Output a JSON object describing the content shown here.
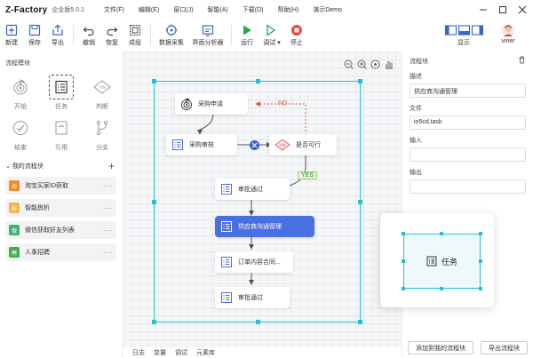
{
  "app": {
    "logo": "Z-Factory",
    "edition": "企业版5.0.1",
    "menus": [
      "文件(F)",
      "编辑(E)",
      "窗口(J)",
      "智能(A)",
      "下载(D)",
      "帮助(H)",
      "演示Demo"
    ]
  },
  "toolbar": {
    "new": "新建",
    "save": "保存",
    "export": "导出",
    "undo": "撤销",
    "redo": "恢复",
    "group": "成组",
    "datacollect": "数据采集",
    "uianalyzer": "界面分析器",
    "run": "运行",
    "debug": "调试",
    "stop": "停止",
    "display": "显示",
    "user": "viner"
  },
  "left": {
    "blocks_title": "流程模块",
    "blocks": [
      "开始",
      "任务",
      "判断",
      "结束",
      "引用",
      "分支"
    ],
    "my_title": "我的流程块",
    "my_items": [
      {
        "label": "淘宝买家ID获取",
        "color": "#f08a24",
        "icon": "淘"
      },
      {
        "label": "智能舆析",
        "color": "#f2b84b",
        "icon": "析"
      },
      {
        "label": "微信获取好友列表",
        "color": "#3cb371",
        "icon": "微"
      },
      {
        "label": "人事招聘",
        "color": "#37b24d",
        "icon": "聘"
      }
    ]
  },
  "flow": {
    "nodes": {
      "purchase_apply": "采购申请",
      "purchase_review": "采购审核",
      "feasible": "是否可行",
      "approve1": "审批通过",
      "supplier": "供应商沟通管理",
      "contract": "订单内容合同...",
      "approve2": "审批通过"
    },
    "no_label": "NO",
    "yes_label": "YES"
  },
  "bottom_tabs": [
    "日志",
    "变量",
    "调试",
    "元素库"
  ],
  "right": {
    "title": "流程块",
    "desc_label": "描述",
    "desc_value": "供应商沟通管理",
    "file_label": "文件",
    "file_value": "io5cd.task",
    "input_label": "输入",
    "input_value": "",
    "output_label": "输出",
    "output_value": "",
    "add_btn": "添加到我的流程块",
    "export_btn": "导出流程块"
  },
  "preview": {
    "label": "任务"
  },
  "colors": {
    "accent": "#4a6fe0",
    "selection": "#2bbfd4",
    "run": "#2aa84a",
    "stop": "#e04b3c"
  }
}
